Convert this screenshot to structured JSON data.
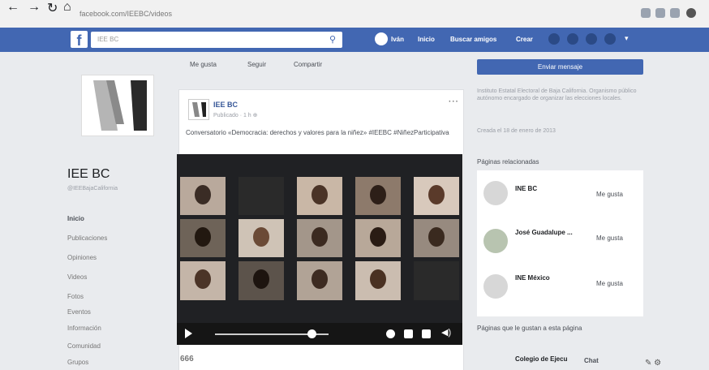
{
  "browser": {
    "url": "facebook.com/IEEBC/videos"
  },
  "topbar": {
    "search_placeholder": "IEE BC",
    "user_name": "Iván",
    "links": [
      "Inicio",
      "Buscar amigos",
      "Crear"
    ]
  },
  "page": {
    "name": "IEE BC",
    "handle": "@IEEBajaCalifornia",
    "nav": [
      "Inicio",
      "Publicaciones",
      "Opiniones",
      "Videos",
      "Fotos",
      "Eventos",
      "Información",
      "Comunidad",
      "Grupos"
    ]
  },
  "post_actions": [
    "Me gusta",
    "Seguir",
    "Compartir"
  ],
  "post": {
    "author": "IEE BC",
    "meta": "Publicado · 1 h",
    "text": "Conversatorio «Democracia: derechos y valores para la niñez» #IEEBC #NiñezParticipativa"
  },
  "video": {
    "progress": 0.85
  },
  "reactions": "666",
  "right": {
    "send_message": "Enviar mensaje",
    "about": "Instituto Estatal Electoral de Baja California. Organismo público autónomo encargado de organizar las elecciones locales.",
    "joined": "Creada el 18 de enero de 2013",
    "related_header": "Páginas relacionadas",
    "related": [
      {
        "name": "INE BC",
        "like": "Me gusta"
      },
      {
        "name": "José Guadalupe ...",
        "like": "Me gusta"
      },
      {
        "name": "INE México",
        "like": "Me gusta"
      }
    ],
    "liked_header": "Páginas que le gustan a esta página",
    "liked": [
      {
        "name": "Colegio de Ejecu"
      }
    ],
    "chat": "Chat"
  }
}
